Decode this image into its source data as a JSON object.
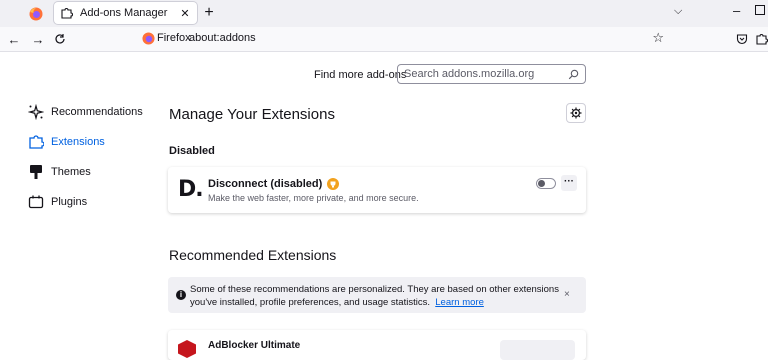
{
  "tab": {
    "title": "Add-ons Manager",
    "close": "✕",
    "new_tab": "+"
  },
  "window": {
    "list_all_tabs": "⌵",
    "minimize": "–"
  },
  "toolbar": {
    "back": "←",
    "forward": "→",
    "reload": "C"
  },
  "urlbar": {
    "identity": "Firefox",
    "url": "about:addons",
    "bookmark": "☆"
  },
  "find": {
    "label": "Find more add-ons",
    "placeholder": "Search addons.mozilla.org"
  },
  "sidebar": {
    "items": [
      {
        "label": "Recommendations",
        "icon": "recommendations-icon",
        "selected": false
      },
      {
        "label": "Extensions",
        "icon": "extensions-icon",
        "selected": true
      },
      {
        "label": "Themes",
        "icon": "themes-icon",
        "selected": false
      },
      {
        "label": "Plugins",
        "icon": "plugins-icon",
        "selected": false
      }
    ]
  },
  "main": {
    "heading": "Manage Your Extensions",
    "section_disabled": "Disabled",
    "extension": {
      "logo": "D.",
      "name": "Disconnect (disabled)",
      "description": "Make the web faster, more private, and more secure.",
      "enabled": false,
      "more": "···"
    },
    "recommended_heading": "Recommended Extensions",
    "notice": {
      "text": "Some of these recommendations are personalized. They are based on other extensions you've installed, profile preferences, and usage statistics.",
      "link": "Learn more",
      "close": "×"
    },
    "recommended_card": {
      "name": "AdBlocker Ultimate"
    }
  },
  "colors": {
    "accent": "#0061e0",
    "chrome": "#f0f0f4",
    "badge": "#f2a21e",
    "rec_logo": "#c5161d"
  }
}
